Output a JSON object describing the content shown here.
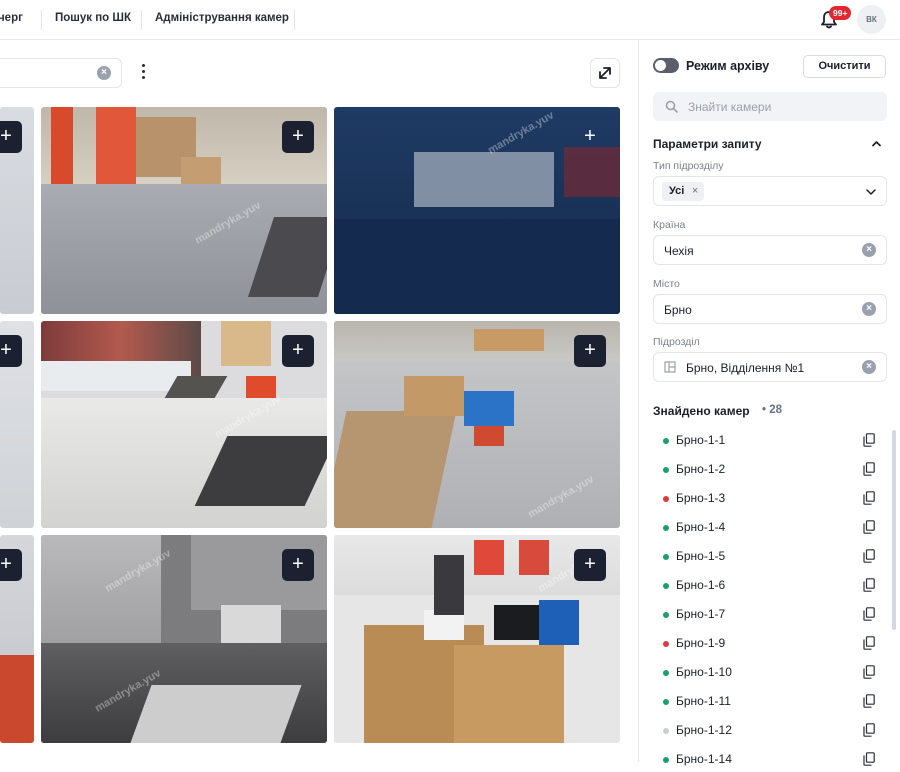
{
  "nav": {
    "items": [
      "черг",
      "Пошук по ШК",
      "Адміністрування камер"
    ],
    "notifications_badge": "99+",
    "avatar_initials": "ВК"
  },
  "panel": {
    "archive_mode_label": "Режим архіву",
    "clear_button": "Очистити",
    "find_placeholder": "Знайти камери",
    "params_title": "Параметри запиту",
    "unit_type_label": "Тип підрозділу",
    "unit_type_chip": "Усі",
    "country_label": "Країна",
    "country_value": "Чехія",
    "city_label": "Місто",
    "city_value": "Брно",
    "unit_label": "Підрозділ",
    "unit_value": "Брно, Відділення №1",
    "found_title": "Знайдено камер",
    "found_count": "• 28",
    "cameras": [
      {
        "name": "Брно-1-1",
        "status": "online"
      },
      {
        "name": "Брно-1-2",
        "status": "online"
      },
      {
        "name": "Брно-1-3",
        "status": "error"
      },
      {
        "name": "Брно-1-4",
        "status": "online"
      },
      {
        "name": "Брно-1-5",
        "status": "online"
      },
      {
        "name": "Брно-1-6",
        "status": "online"
      },
      {
        "name": "Брно-1-7",
        "status": "online"
      },
      {
        "name": "Брно-1-9",
        "status": "error"
      },
      {
        "name": "Брно-1-10",
        "status": "online"
      },
      {
        "name": "Брно-1-11",
        "status": "online"
      },
      {
        "name": "Брно-1-12",
        "status": "offline"
      },
      {
        "name": "Брно-1-14",
        "status": "online"
      }
    ]
  },
  "colors": {
    "online": "#1e9e6a",
    "error": "#e03a3e",
    "offline": "#c9ccd3",
    "accent_dark": "#1b2130"
  },
  "camera_watermark": "mandryka.yuv"
}
